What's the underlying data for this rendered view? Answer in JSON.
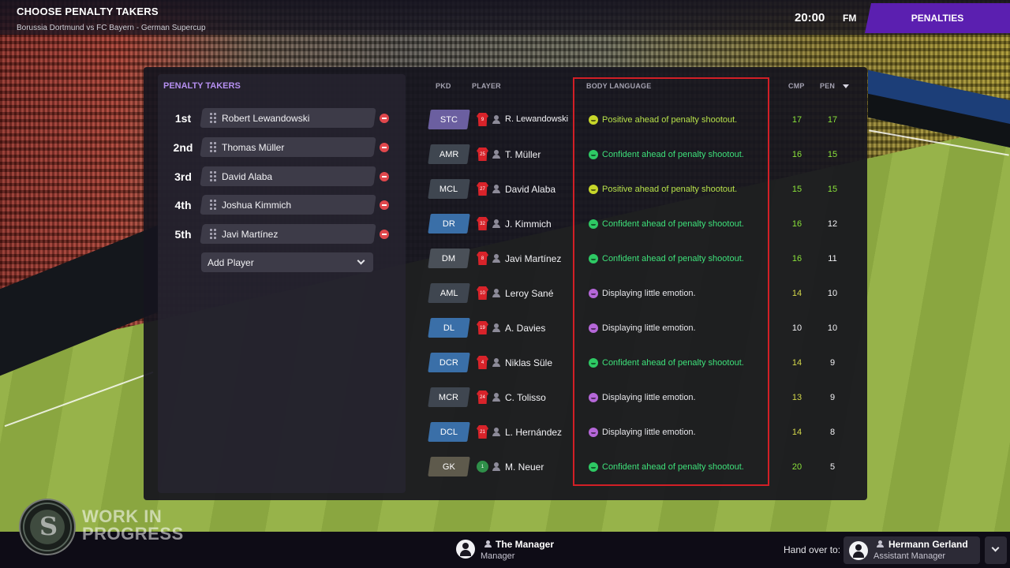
{
  "header": {
    "title": "CHOOSE PENALTY TAKERS",
    "subtitle": "Borussia Dortmund vs FC Bayern  -  German Supercup",
    "time": "20:00",
    "logo": "FM",
    "active_tab": "PENALTIES"
  },
  "penalty_takers": {
    "heading": "PENALTY TAKERS",
    "takers": [
      {
        "rank": "1st",
        "name": "Robert Lewandowski"
      },
      {
        "rank": "2nd",
        "name": "Thomas Müller"
      },
      {
        "rank": "3rd",
        "name": "David Alaba"
      },
      {
        "rank": "4th",
        "name": "Joshua Kimmich"
      },
      {
        "rank": "5th",
        "name": "Javi Martínez"
      }
    ],
    "add_player_label": "Add Player"
  },
  "table": {
    "columns": {
      "pkd": "PKD",
      "player": "PLAYER",
      "body_language": "BODY LANGUAGE",
      "cmp": "CMP",
      "pen": "PEN"
    },
    "rows": [
      {
        "pos": "STC",
        "pos_color": "#6b5fa0",
        "shirt": "9",
        "name": "R. Lewandowski",
        "mood": "positive",
        "emotion": "Positive ahead of penalty shootout.",
        "cmp": "17",
        "pen": "17"
      },
      {
        "pos": "AMR",
        "pos_color": "#3f4650",
        "shirt": "25",
        "name": "T. Müller",
        "mood": "confident",
        "emotion": "Confident ahead of penalty shootout.",
        "cmp": "16",
        "pen": "15"
      },
      {
        "pos": "MCL",
        "pos_color": "#3f4650",
        "shirt": "27",
        "name": "David Alaba",
        "mood": "positive",
        "emotion": "Positive ahead of penalty shootout.",
        "cmp": "15",
        "pen": "15"
      },
      {
        "pos": "DR",
        "pos_color": "#3a6fa8",
        "shirt": "32",
        "name": "J. Kimmich",
        "mood": "confident",
        "emotion": "Confident ahead of penalty shootout.",
        "cmp": "16",
        "pen": "12"
      },
      {
        "pos": "DM",
        "pos_color": "#4a5058",
        "shirt": "8",
        "name": "Javi Martínez",
        "mood": "confident",
        "emotion": "Confident ahead of penalty shootout.",
        "cmp": "16",
        "pen": "11"
      },
      {
        "pos": "AML",
        "pos_color": "#3f4650",
        "shirt": "10",
        "name": "Leroy Sané",
        "mood": "neutral",
        "emotion": "Displaying little emotion.",
        "cmp": "14",
        "pen": "10"
      },
      {
        "pos": "DL",
        "pos_color": "#3a6fa8",
        "shirt": "19",
        "name": "A. Davies",
        "mood": "neutral",
        "emotion": "Displaying little emotion.",
        "cmp": "10",
        "pen": "10"
      },
      {
        "pos": "DCR",
        "pos_color": "#3a6fa8",
        "shirt": "4",
        "name": "Niklas Süle",
        "mood": "confident",
        "emotion": "Confident ahead of penalty shootout.",
        "cmp": "14",
        "pen": "9"
      },
      {
        "pos": "MCR",
        "pos_color": "#3f4650",
        "shirt": "24",
        "name": "C. Tolisso",
        "mood": "neutral",
        "emotion": "Displaying little emotion.",
        "cmp": "13",
        "pen": "9"
      },
      {
        "pos": "DCL",
        "pos_color": "#3a6fa8",
        "shirt": "21",
        "name": "L. Hernández",
        "mood": "neutral",
        "emotion": "Displaying little emotion.",
        "cmp": "14",
        "pen": "8"
      },
      {
        "pos": "GK",
        "pos_color": "#5e5a4c",
        "shirt": "1",
        "name": "M. Neuer",
        "mood": "confident",
        "emotion": "Confident ahead of penalty shootout.",
        "cmp": "20",
        "pen": "5",
        "goalkeeper": true
      }
    ]
  },
  "moods": {
    "positive": {
      "icon_color": "#c7d62a",
      "text_color": "#b6e04a"
    },
    "confident": {
      "icon_color": "#2ec964",
      "text_color": "#3ee07a"
    },
    "neutral": {
      "icon_color": "#b567d8",
      "text_color": "#e6e6ea"
    }
  },
  "value_colors": {
    "high": "#8ae23a",
    "mid": "#d4d84a",
    "low": "#f2f2f5"
  },
  "footer": {
    "watermark": "WORK IN\nPROGRESS",
    "manager_name": "The Manager",
    "manager_role": "Manager",
    "handover_label": "Hand over to:",
    "assistant_name": "Hermann Gerland",
    "assistant_role": "Assistant Manager"
  },
  "colors": {
    "accent_purple": "#5b1fb0",
    "heading_purple": "#b58ff0",
    "highlight_red": "#d21f26",
    "remove_red": "#e0474c"
  }
}
